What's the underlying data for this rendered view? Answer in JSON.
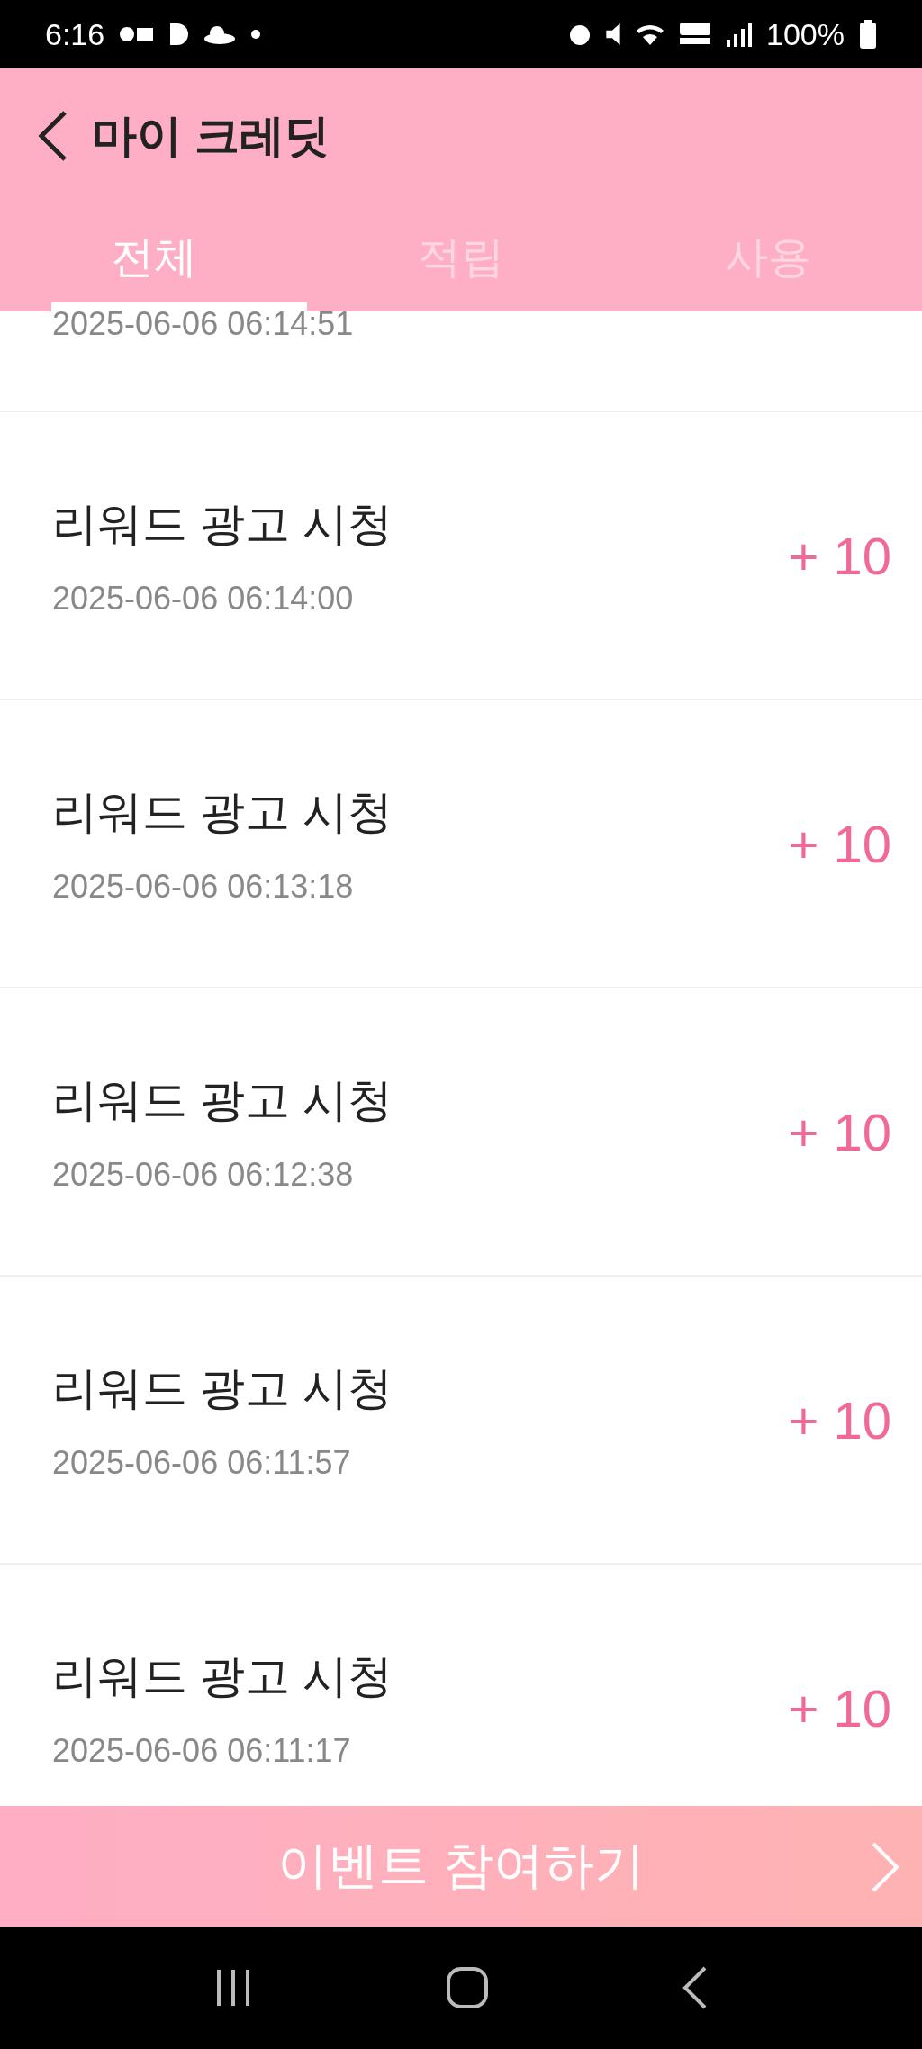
{
  "status_bar": {
    "time": "6:16",
    "battery": "100%"
  },
  "header": {
    "title": "마이 크레딧"
  },
  "tabs": [
    {
      "label": "전체",
      "selected": true
    },
    {
      "label": "적립",
      "selected": false
    },
    {
      "label": "사용",
      "selected": false
    }
  ],
  "history": [
    {
      "date": "2025-06-06 06:14:51"
    },
    {
      "title": "리워드 광고 시청",
      "date": "2025-06-06 06:14:00",
      "amount": "+ 10"
    },
    {
      "title": "리워드 광고 시청",
      "date": "2025-06-06 06:13:18",
      "amount": "+ 10"
    },
    {
      "title": "리워드 광고 시청",
      "date": "2025-06-06 06:12:38",
      "amount": "+ 10"
    },
    {
      "title": "리워드 광고 시청",
      "date": "2025-06-06 06:11:57",
      "amount": "+ 10"
    },
    {
      "title": "리워드 광고 시청",
      "date": "2025-06-06 06:11:17",
      "amount": "+ 10"
    }
  ],
  "event_button": {
    "label": "이벤트 참여하기"
  }
}
